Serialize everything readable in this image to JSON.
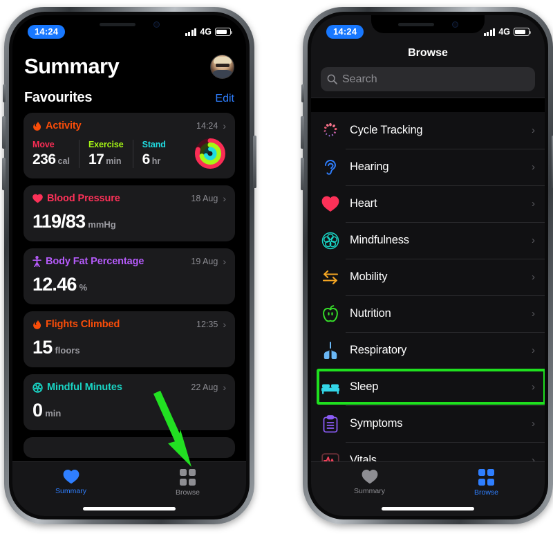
{
  "status": {
    "time": "14:24",
    "network": "4G",
    "signal_icon": "cellular-signal-icon",
    "battery_icon": "battery-icon"
  },
  "left_phone": {
    "screen_name": "Summary",
    "header": {
      "title": "Summary",
      "avatar_name": "profile-avatar"
    },
    "favourites": {
      "section_title": "Favourites",
      "edit_label": "Edit"
    },
    "cards": [
      {
        "name": "Activity",
        "icon": "flame-icon",
        "color": "#fa4d09",
        "timestamp": "14:24",
        "type": "activity",
        "rings": [
          {
            "label": "Move",
            "value": "236",
            "unit": "cal",
            "color": "#fa2d55"
          },
          {
            "label": "Exercise",
            "value": "17",
            "unit": "min",
            "color": "#a6f715"
          },
          {
            "label": "Stand",
            "value": "6",
            "unit": "hr",
            "color": "#20dbe0"
          }
        ]
      },
      {
        "name": "Blood Pressure",
        "icon": "heart-icon",
        "color": "#fc3158",
        "timestamp": "18 Aug",
        "type": "metric",
        "value": "119/83",
        "unit": "mmHg"
      },
      {
        "name": "Body Fat Percentage",
        "icon": "body-figure-icon",
        "color": "#b55bfa",
        "timestamp": "19 Aug",
        "type": "metric",
        "value": "12.46",
        "unit": "%"
      },
      {
        "name": "Flights Climbed",
        "icon": "flame-icon",
        "color": "#fa4d09",
        "timestamp": "12:35",
        "type": "metric",
        "value": "15",
        "unit": "floors"
      },
      {
        "name": "Mindful Minutes",
        "icon": "mindfulness-icon",
        "color": "#19d5c5",
        "timestamp": "22 Aug",
        "type": "metric",
        "value": "0",
        "unit": "min"
      }
    ],
    "tabs": [
      {
        "label": "Summary",
        "icon": "heart-icon",
        "active": true
      },
      {
        "label": "Browse",
        "icon": "grid-icon",
        "active": false
      }
    ]
  },
  "right_phone": {
    "screen_name": "Browse",
    "header": {
      "title": "Browse"
    },
    "search": {
      "placeholder": "Search",
      "icon": "search-icon"
    },
    "list": [
      {
        "label": "Cycle Tracking",
        "icon": "cycle-tracking-icon",
        "color": "#f4738b",
        "highlighted": false
      },
      {
        "label": "Hearing",
        "icon": "ear-icon",
        "color": "#2f7fff",
        "highlighted": false
      },
      {
        "label": "Heart",
        "icon": "heart-icon",
        "color": "#fc3158",
        "highlighted": false
      },
      {
        "label": "Mindfulness",
        "icon": "mindfulness-icon",
        "color": "#19d5c5",
        "highlighted": false
      },
      {
        "label": "Mobility",
        "icon": "mobility-arrows-icon",
        "color": "#f5a623",
        "highlighted": false
      },
      {
        "label": "Nutrition",
        "icon": "apple-icon",
        "color": "#37e22a",
        "highlighted": false
      },
      {
        "label": "Respiratory",
        "icon": "lungs-icon",
        "color": "#6ab7f5",
        "highlighted": false
      },
      {
        "label": "Sleep",
        "icon": "bed-icon",
        "color": "#33d6e8",
        "highlighted": true
      },
      {
        "label": "Symptoms",
        "icon": "clipboard-icon",
        "color": "#8b5cf6",
        "highlighted": false
      },
      {
        "label": "Vitals",
        "icon": "vitals-pulse-icon",
        "color": "#f0405a",
        "highlighted": false
      }
    ],
    "tabs": [
      {
        "label": "Summary",
        "icon": "heart-icon",
        "active": false
      },
      {
        "label": "Browse",
        "icon": "grid-icon",
        "active": true
      }
    ]
  },
  "annotations": {
    "arrow_color": "#22e022",
    "highlight_color": "#1fe01f",
    "arrow_name": "green-pointer-arrow",
    "highlight_name": "green-highlight-box"
  }
}
